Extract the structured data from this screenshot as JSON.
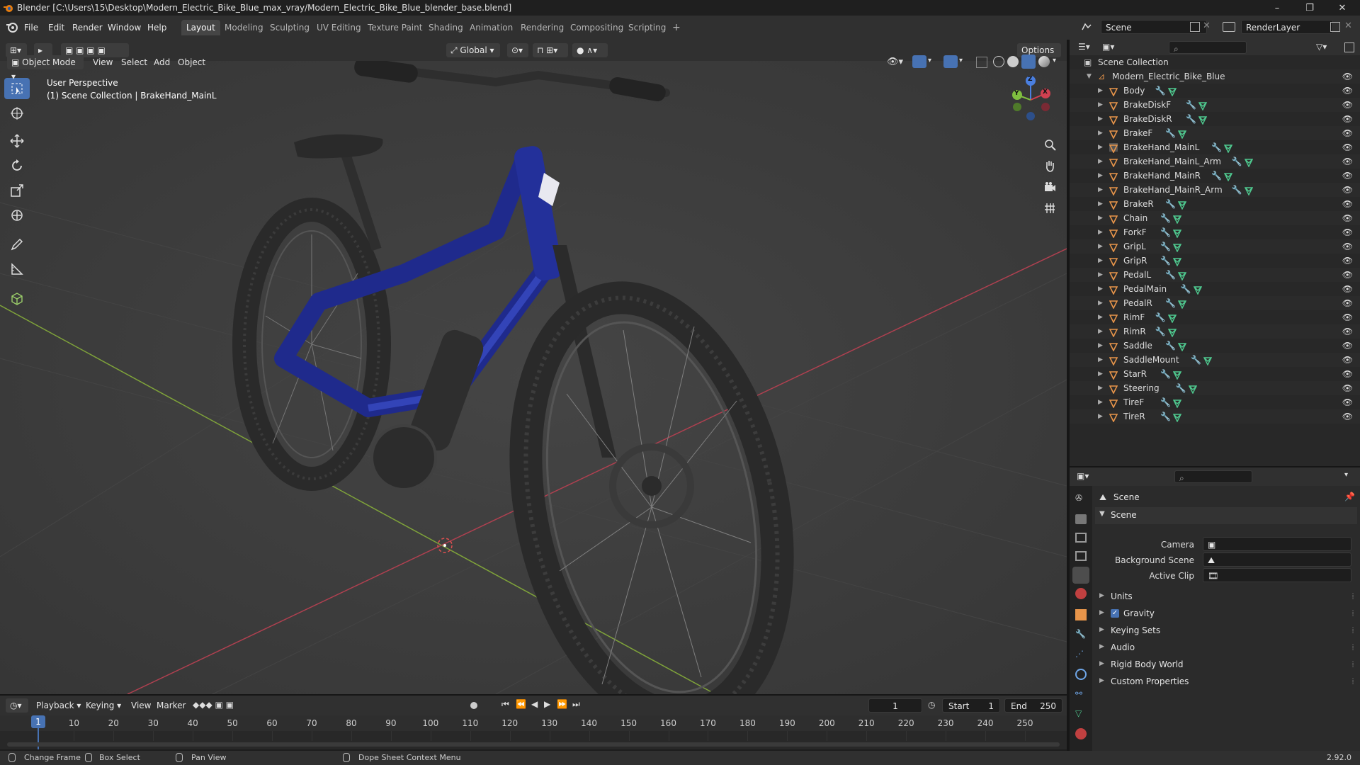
{
  "window": {
    "title": "Blender [C:\\Users\\15\\Desktop\\Modern_Electric_Bike_Blue_max_vray/Modern_Electric_Bike_Blue_blender_base.blend]",
    "controls": [
      "–",
      "❐",
      "✕"
    ]
  },
  "menu": [
    "File",
    "Edit",
    "Render",
    "Window",
    "Help"
  ],
  "workspaces": [
    "Layout",
    "Modeling",
    "Sculpting",
    "UV Editing",
    "Texture Paint",
    "Shading",
    "Animation",
    "Rendering",
    "Compositing",
    "Scripting",
    "+"
  ],
  "active_workspace": "Layout",
  "scene_field": "Scene",
  "renderlayer_field": "RenderLayer",
  "viewport_header": {
    "mode": "Object Mode",
    "menus": [
      "View",
      "Select",
      "Add",
      "Object"
    ],
    "orientation": "Global",
    "options": "Options"
  },
  "viewport": {
    "overlay_line1": "User Perspective",
    "overlay_line2": "(1) Scene Collection | BrakeHand_MainL",
    "gizmo_labels": {
      "z": "Z",
      "y": "Y",
      "x": "X"
    }
  },
  "outliner": {
    "root": "Scene Collection",
    "collection": "Modern_Electric_Bike_Blue",
    "objects": [
      "Body",
      "BrakeDiskF",
      "BrakeDiskR",
      "BrakeF",
      "BrakeHand_MainL",
      "BrakeHand_MainL_Arm",
      "BrakeHand_MainR",
      "BrakeHand_MainR_Arm",
      "BrakeR",
      "Chain",
      "ForkF",
      "GripL",
      "GripR",
      "PedalL",
      "PedalMain",
      "PedalR",
      "RimF",
      "RimR",
      "Saddle",
      "SaddleMount",
      "StarR",
      "Steering",
      "TireF",
      "TireR"
    ],
    "active_object": "BrakeHand_MainL"
  },
  "properties": {
    "context_title": "Scene",
    "panel_title": "Scene",
    "fields": [
      {
        "label": "Camera",
        "value": ""
      },
      {
        "label": "Background Scene",
        "value": ""
      },
      {
        "label": "Active Clip",
        "value": ""
      }
    ],
    "subpanels": [
      "Units",
      "Gravity",
      "Keying Sets",
      "Audio",
      "Rigid Body World",
      "Custom Properties"
    ],
    "gravity_checked": true
  },
  "timeline": {
    "menus": [
      "Playback",
      "Keying",
      "View",
      "Marker"
    ],
    "current_frame": "1",
    "start_label": "Start",
    "start": "1",
    "end_label": "End",
    "end": "250",
    "ticks": [
      "10",
      "20",
      "30",
      "40",
      "50",
      "60",
      "70",
      "80",
      "90",
      "100",
      "110",
      "120",
      "130",
      "140",
      "150",
      "160",
      "170",
      "180",
      "190",
      "200",
      "210",
      "220",
      "230",
      "240",
      "250"
    ],
    "playhead": "1"
  },
  "statusbar": {
    "items": [
      "Change Frame",
      "Box Select",
      "Pan View",
      "Dope Sheet Context Menu"
    ],
    "version": "2.92.0"
  },
  "colors": {
    "accent": "#4772b3",
    "object_icon": "#e8954a",
    "mesh_icon": "#4fc98f",
    "modifier_icon": "#6fa6e8"
  }
}
